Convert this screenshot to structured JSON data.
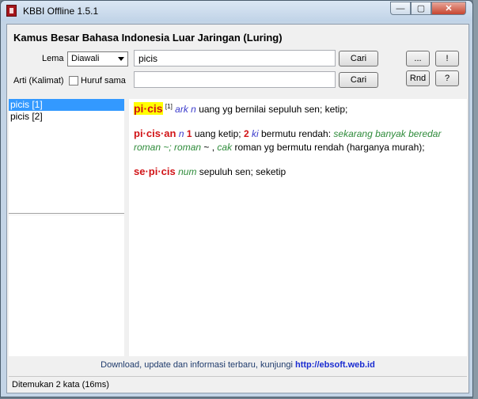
{
  "window": {
    "title": "KBBI Offline 1.5.1",
    "minimize_glyph": "—",
    "maximize_glyph": "▢",
    "close_glyph": "✕"
  },
  "heading": "Kamus Besar Bahasa Indonesia Luar Jaringan (Luring)",
  "form": {
    "lema_label": "Lema",
    "mode_selected": "Diawali",
    "lema_value": "picis",
    "arti_label": "Arti (Kalimat)",
    "huruf_sama_label": "Huruf sama",
    "arti_value": "",
    "cari_label_1": "Cari",
    "cari_label_2": "Cari",
    "more_label": "...",
    "bang_label": "!",
    "rnd_label": "Rnd",
    "help_label": "?"
  },
  "results": [
    "picis [1]",
    "picis [2]"
  ],
  "definitions": {
    "e1": {
      "hw": "pi·cis",
      "sup": "[1]",
      "abbr": "ark n",
      "text": "uang yg bernilai sepuluh sen; ketip;"
    },
    "e2": {
      "hw": "pi·cis·an",
      "abbr1": "n",
      "n1": "1",
      "t1": "uang ketip;",
      "n2": "2",
      "abbr2": "ki",
      "t2": "bermutu rendah:",
      "ex1": "sekarang banyak beredar roman ~; roman",
      "t3": "~ ,",
      "abbr3": "cak",
      "t4": "roman yg bermutu rendah (harganya murah);"
    },
    "e3": {
      "hw": "se·pi·cis",
      "abbr": "num",
      "text": "sepuluh sen; seketip"
    }
  },
  "footer": {
    "text": "Download, update dan informasi terbaru, kunjungi",
    "link": "http://ebsoft.web.id"
  },
  "status": "Ditemukan 2 kata (16ms)"
}
